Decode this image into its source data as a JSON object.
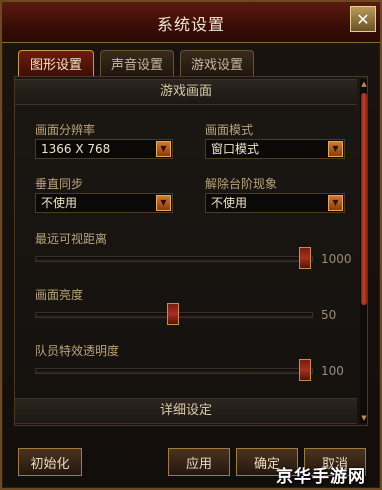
{
  "window": {
    "title": "系统设置",
    "close_symbol": "✕"
  },
  "tabs": [
    {
      "label": "图形设置",
      "active": true
    },
    {
      "label": "声音设置",
      "active": false
    },
    {
      "label": "游戏设置",
      "active": false
    }
  ],
  "sections": {
    "game_screen": "游戏画面",
    "detail": "详细设定"
  },
  "settings": {
    "resolution": {
      "label": "画面分辨率",
      "value": "1366 X 768"
    },
    "display_mode": {
      "label": "画面模式",
      "value": "窗口模式"
    },
    "vsync": {
      "label": "垂直同步",
      "value": "不使用"
    },
    "step_fix": {
      "label": "解除台阶现象",
      "value": "不使用"
    }
  },
  "sliders": {
    "view_distance": {
      "label": "最远可视距离",
      "value": "1000",
      "fraction": 1.0
    },
    "brightness": {
      "label": "画面亮度",
      "value": "50",
      "fraction": 0.5
    },
    "party_effect_opacity": {
      "label": "队员特效透明度",
      "value": "100",
      "fraction": 1.0
    }
  },
  "buttons": {
    "reset": "初始化",
    "apply": "应用",
    "ok": "确定",
    "cancel": "取消"
  },
  "icons": {
    "dropdown_arrow": "▼",
    "scroll_up": "▲",
    "scroll_down": "▼"
  },
  "watermark": "京华手游网",
  "colors": {
    "accent": "#c98a4a",
    "active_tab": "#6e1c0e"
  }
}
